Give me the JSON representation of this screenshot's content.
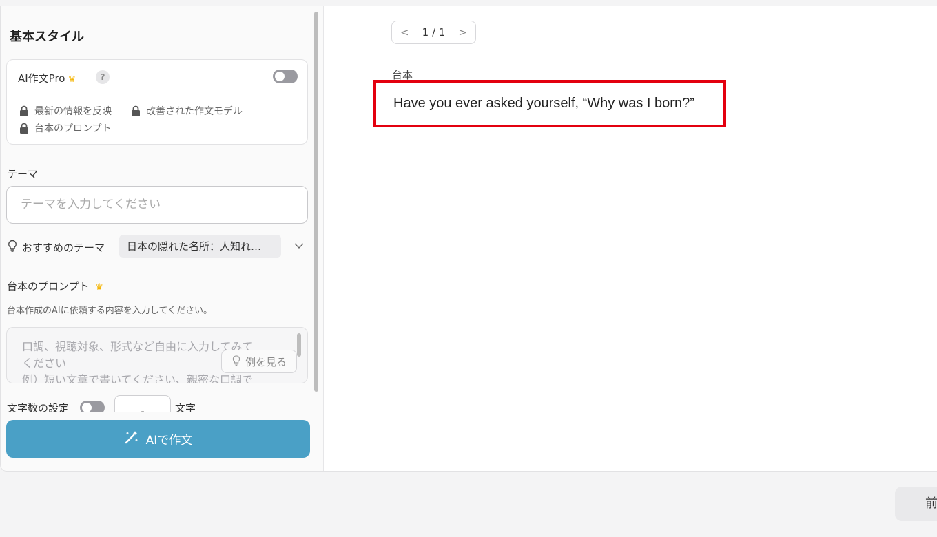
{
  "left_panel": {
    "section_title": "基本スタイル",
    "pro": {
      "title": "AI作文Pro",
      "crown_icon": "crown-icon",
      "help_label": "?",
      "features": [
        "最新の情報を反映",
        "改善された作文モデル",
        "台本のプロンプト"
      ]
    },
    "theme": {
      "label": "テーマ",
      "placeholder": "テーマを入力してください"
    },
    "recommended": {
      "label": "おすすめのテーマ",
      "selected": "日本の隠れた名所：人知れ…"
    },
    "prompt": {
      "title": "台本のプロンプト",
      "description": "台本作成のAIに依頼する内容を入力してください。",
      "placeholder_line1": "口調、視聴対象、形式など自由に入力してみて",
      "placeholder_line2": "ください",
      "placeholder_line3": "例）短い文章で書いてください、親密な口調で",
      "example_button": "例を見る"
    },
    "char_count": {
      "label": "文字数の設定",
      "value": "-",
      "unit": "文字"
    },
    "ai_button": "AIで作文"
  },
  "right_panel": {
    "pager": {
      "text": "1 / 1",
      "prev": "<",
      "next": ">"
    },
    "script_label": "台本",
    "script_text": "Have you ever asked yourself, “Why was I born?”"
  },
  "footer": {
    "next_button_partial": "前"
  },
  "colors": {
    "accent": "#4aa0c6",
    "highlight_border": "#e3000f",
    "crown": "#f5b400"
  }
}
